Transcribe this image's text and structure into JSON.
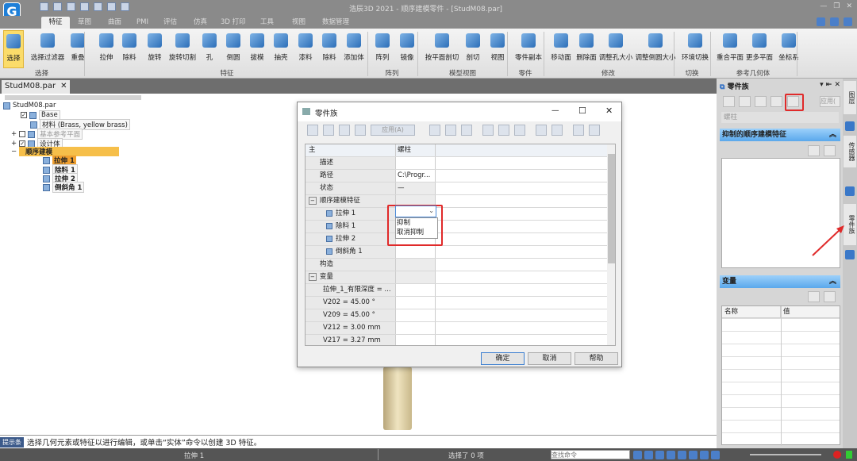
{
  "app": {
    "title": "浩辰3D 2021 - 顺序建模零件 - [StudM08.par]",
    "logo": "G"
  },
  "tabs": [
    {
      "label": "特征",
      "active": true
    },
    {
      "label": "草图"
    },
    {
      "label": "曲面"
    },
    {
      "label": "PMI"
    },
    {
      "label": "评估"
    },
    {
      "label": "仿真"
    },
    {
      "label": "3D 打印"
    },
    {
      "label": "工具"
    },
    {
      "label": "视图"
    },
    {
      "label": "数据管理"
    }
  ],
  "ribbon": {
    "buttons": [
      "选择",
      "选择过滤器",
      "重叠",
      "拉伸",
      "除料",
      "旋转",
      "旋转切割",
      "孔",
      "倒圆",
      "拔模",
      "抽壳",
      "漆料",
      "除料",
      "添加体",
      "阵列",
      "镜像",
      "按平面剖切",
      "剖切",
      "视图",
      "零件副本",
      "移动面",
      "删除面",
      "调整孔大小",
      "调整倒圆大小",
      "环境切换",
      "重合平面",
      "更多平面",
      "坐标系"
    ],
    "groups": [
      "选择",
      "特征",
      "阵列",
      "模型视图",
      "零件",
      "修改",
      "切换",
      "参考几何体"
    ]
  },
  "document_tab": {
    "label": "StudM08.par",
    "close": "✕"
  },
  "tree": {
    "root": "StudM08.par",
    "items": [
      "Base",
      "材料 (Brass, yellow brass)",
      "基本参考平面",
      "设计体",
      "顺序建模",
      "拉伸 1",
      "除料 1",
      "拉伸 2",
      "倒斜角 1"
    ]
  },
  "dialog": {
    "title": "零件族",
    "apply": "应用(A)",
    "header": [
      "主",
      "螺柱"
    ],
    "rows": [
      {
        "name": "描述",
        "value": ""
      },
      {
        "name": "路径",
        "value": "C:\\Progr..."
      },
      {
        "name": "状态",
        "value": "—"
      },
      {
        "name": "顺序建模特征",
        "value": "",
        "group": true
      },
      {
        "name": "拉伸 1",
        "value": ""
      },
      {
        "name": "除料 1",
        "value": ""
      },
      {
        "name": "拉伸 2",
        "value": ""
      },
      {
        "name": "倒斜角 1",
        "value": ""
      },
      {
        "name": "构造",
        "value": ""
      },
      {
        "name": "变量",
        "value": "",
        "group": true
      },
      {
        "name": "拉伸_1_有限深度 = ...",
        "value": ""
      },
      {
        "name": "V202 = 45.00 °",
        "value": ""
      },
      {
        "name": "V209 = 45.00 °",
        "value": ""
      },
      {
        "name": "V212 = 3.00 mm",
        "value": ""
      },
      {
        "name": "V217 = 3.27 mm",
        "value": ""
      }
    ],
    "dropdown_options": [
      "抑制",
      "取消抑制"
    ],
    "ok": "确定",
    "cancel": "取消",
    "help": "帮助"
  },
  "right_panel": {
    "title": "零件族",
    "apply": "应用(",
    "member": "螺柱",
    "suppressed_header": "抑制的顺序建模特征",
    "variables_header": "变量",
    "var_cols": [
      "名称",
      "值"
    ]
  },
  "side_tabs": [
    "图层",
    "传感器",
    "零件族"
  ],
  "prompt": {
    "tag": "提示条",
    "text": "选择几何元素或特征以进行编辑，或单击“实体”命令以创建 3D 特征。"
  },
  "status": {
    "left": "拉伸 1",
    "middle": "选择了 0 项",
    "search_placeholder": "查找命令"
  },
  "colors": {
    "highlight": "#e02a2a",
    "selection": "#fbdc6a",
    "panel_header": "#5aa8ec"
  }
}
